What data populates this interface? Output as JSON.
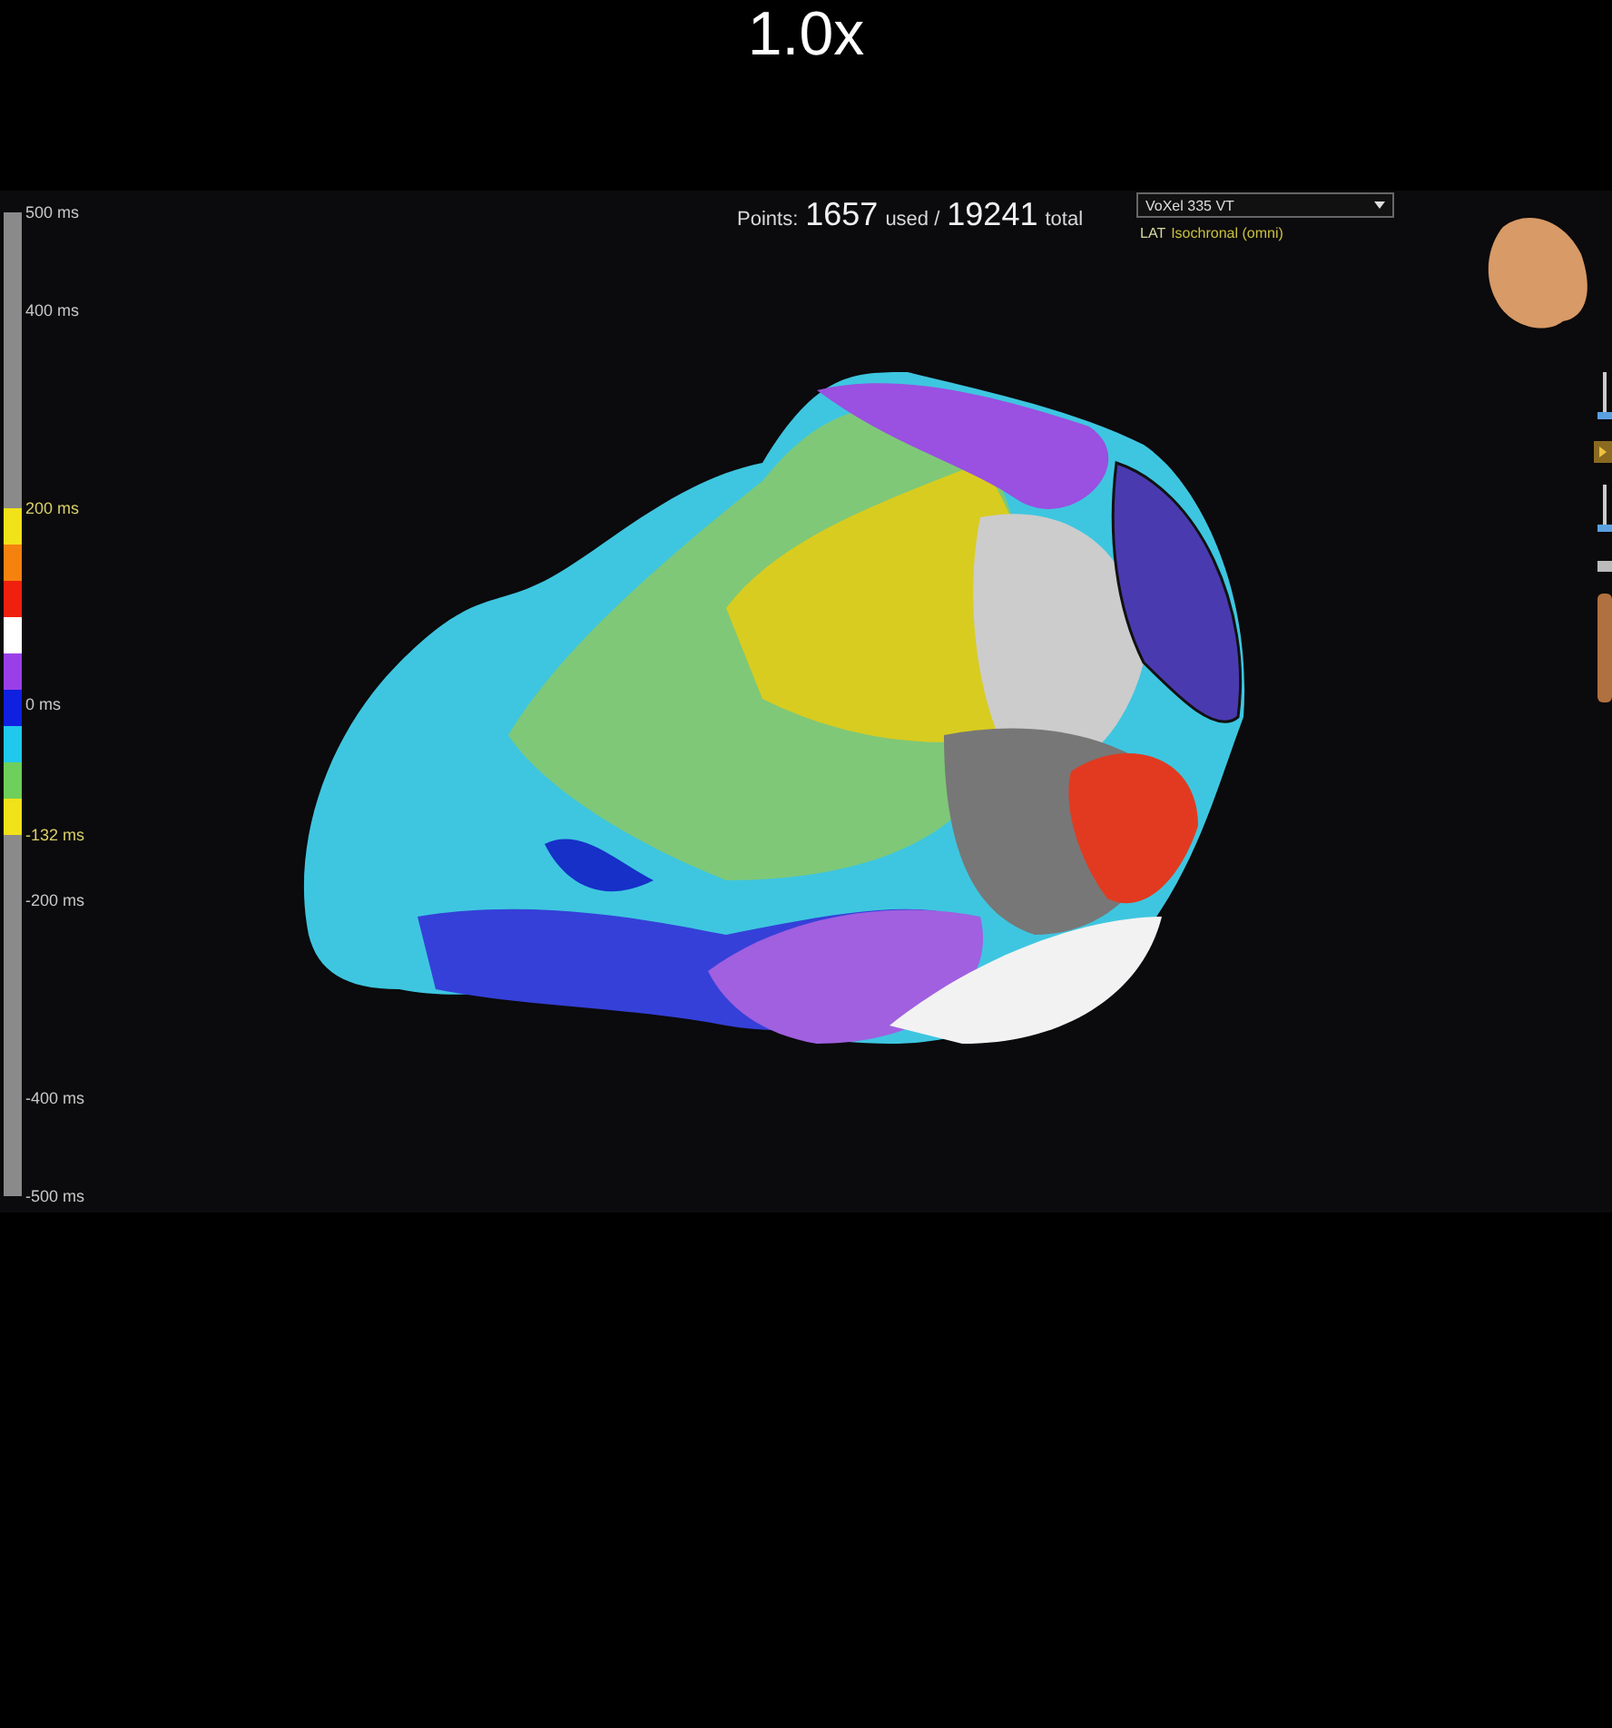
{
  "playback_speed": "1.0x",
  "scale": {
    "ticks": [
      {
        "label": "500 ms",
        "highlighted": false
      },
      {
        "label": "400 ms",
        "highlighted": false
      },
      {
        "label": "200 ms",
        "highlighted": true
      },
      {
        "label": "0 ms",
        "highlighted": false
      },
      {
        "label": "-132 ms",
        "highlighted": true
      },
      {
        "label": "-200 ms",
        "highlighted": false
      },
      {
        "label": "-400 ms",
        "highlighted": false
      },
      {
        "label": "-500 ms",
        "highlighted": false
      }
    ],
    "bands": [
      {
        "color": "#f2e21a"
      },
      {
        "color": "#f5820f"
      },
      {
        "color": "#f0200f"
      },
      {
        "color": "#ffffff"
      },
      {
        "color": "#9a3fe8"
      },
      {
        "color": "#1020e0"
      },
      {
        "color": "#20c8ee"
      },
      {
        "color": "#6ecf5a"
      },
      {
        "color": "#f2e21a"
      }
    ]
  },
  "header": {
    "points_label": "Points:",
    "used_count": "1657",
    "used_label": "used /",
    "total_count": "19241",
    "total_label": "total",
    "map_select": "VoXel 335 VT",
    "map_type_label": "LAT",
    "map_type": "Isochronal (omni)"
  }
}
